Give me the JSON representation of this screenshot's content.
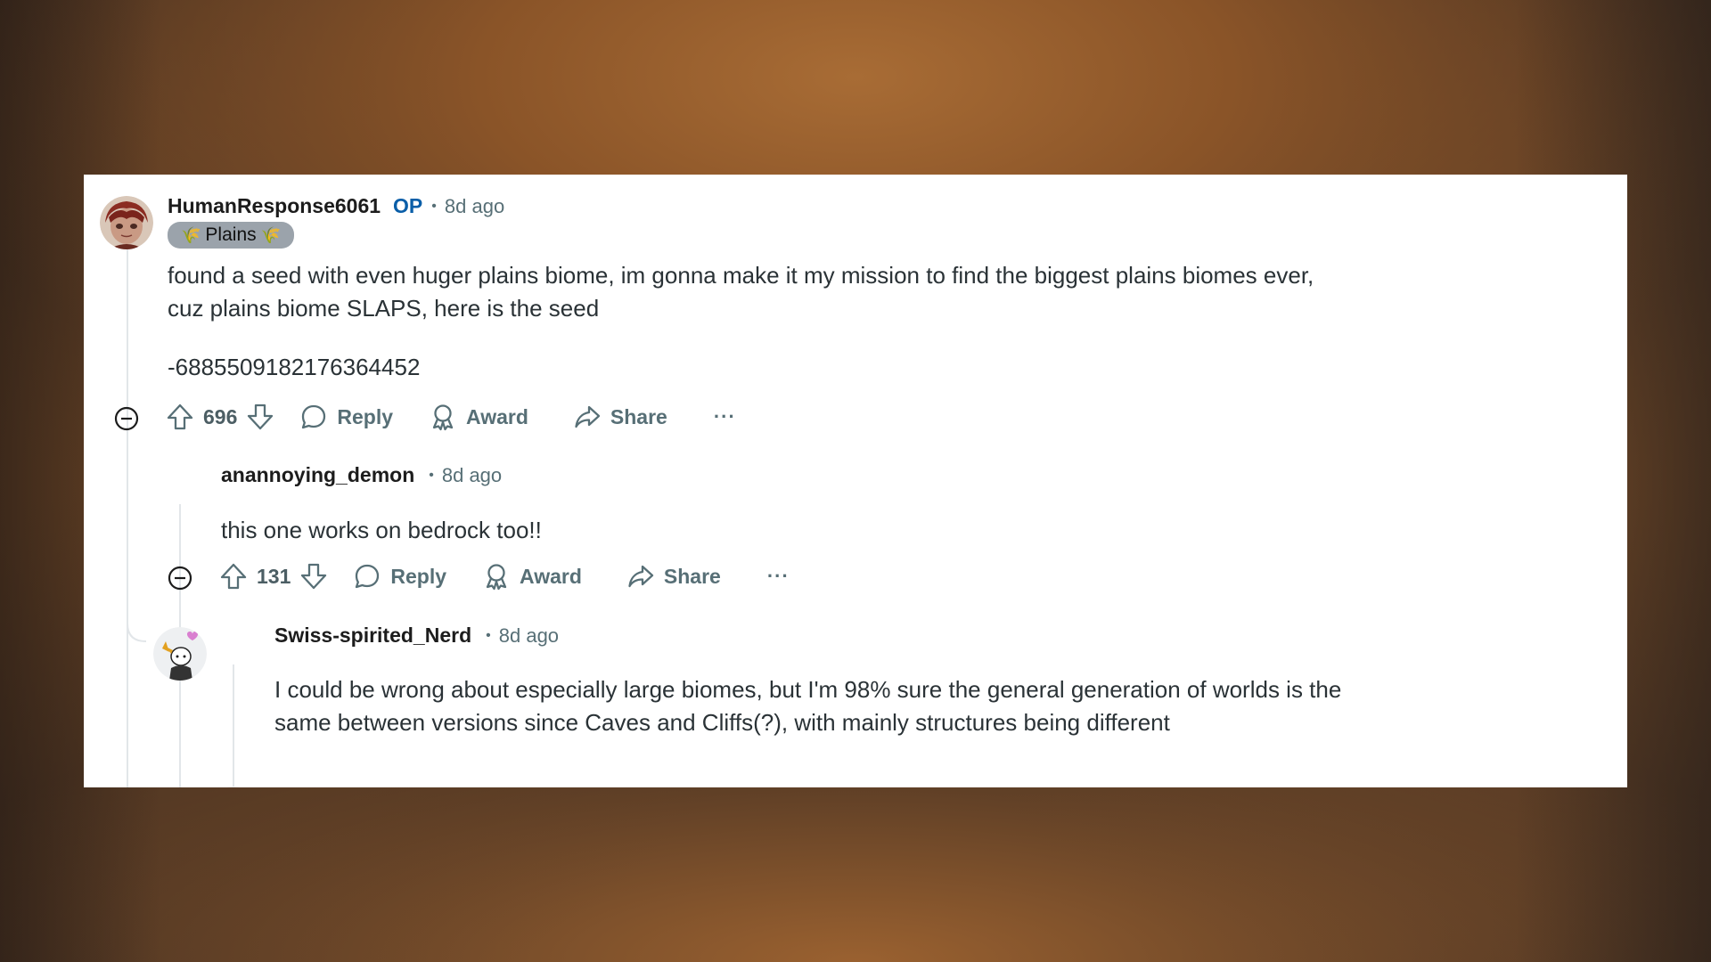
{
  "comments": [
    {
      "username": "HumanResponse6061",
      "op_label": "OP",
      "separator": "•",
      "time": "8d ago",
      "flair_left": "🌾",
      "flair_text": "Plains",
      "flair_right": "🌾",
      "body_line1": "found a seed with even huger plains biome, im gonna make it my mission to find the biggest plains biomes ever, cuz plains biome SLAPS, here is the seed",
      "body_line2": "-6885509182176364452",
      "score": "696",
      "reply_label": "Reply",
      "award_label": "Award",
      "share_label": "Share",
      "more_label": "···"
    },
    {
      "username": "anannoying_demon",
      "separator": "•",
      "time": "8d ago",
      "body_line1": "this one works on bedrock too!!",
      "score": "131",
      "reply_label": "Reply",
      "award_label": "Award",
      "share_label": "Share",
      "more_label": "···"
    },
    {
      "username": "Swiss-spirited_Nerd",
      "separator": "•",
      "time": "8d ago",
      "body_line1": "I could be wrong about especially large biomes, but I'm 98% sure the general generation of worlds is the same between versions since Caves and Cliffs(?), with mainly structures being different"
    }
  ],
  "colors": {
    "op": "#0a5ea8",
    "meta": "#576f76",
    "thread_line": "#e2e6e9"
  },
  "icons": [
    "upvote-icon",
    "downvote-icon",
    "reply-icon",
    "award-icon",
    "share-icon",
    "collapse-icon",
    "more-icon"
  ]
}
